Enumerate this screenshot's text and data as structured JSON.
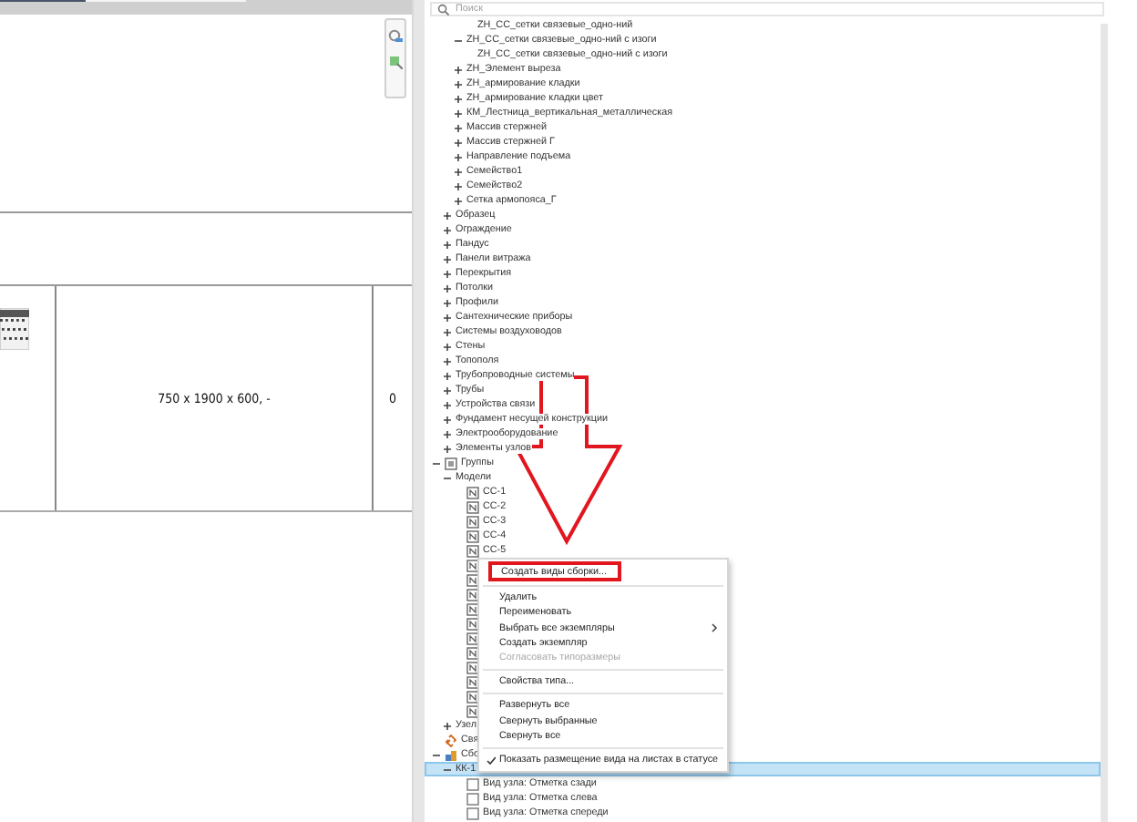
{
  "view": {
    "table": {
      "rows": [
        {
          "cells": [
            "750 x 1900 x 600, -",
            "0"
          ]
        }
      ]
    }
  },
  "search": {
    "placeholder": "Поиск"
  },
  "tree": [
    {
      "children": [
        {
          "children": [
            {
              "children": [
                {
                  "label": "ZH_CC_сетки связевые_одно-ний",
                  "selected": false
                }
              ]
            },
            {
              "label": "ZH_CC_сетки связевые_одно-ний с изоги",
              "expanded": true,
              "selected": false,
              "children": [
                {
                  "label": "ZH_CC_сетки связевые_одно-ний с изоги",
                  "selected": false
                }
              ]
            },
            {
              "label": "ZH_Элемент выреза",
              "expanded": false,
              "selected": false
            },
            {
              "label": "ZH_армирование кладки",
              "expanded": false,
              "selected": false
            },
            {
              "label": "ZH_армирование кладки цвет",
              "expanded": false,
              "selected": false
            },
            {
              "label": "КМ_Лестница_вертикальная_металлическая",
              "expanded": false,
              "selected": false
            },
            {
              "label": "Массив стержней",
              "expanded": false,
              "selected": false
            },
            {
              "label": "Массив стержней Г",
              "expanded": false,
              "selected": false
            },
            {
              "label": "Направление подъема",
              "expanded": false,
              "selected": false
            },
            {
              "label": "Семейство1",
              "expanded": false,
              "selected": false
            },
            {
              "label": "Семейство2",
              "expanded": false,
              "selected": false
            },
            {
              "label": "Сетка армопояса_Г",
              "expanded": false,
              "selected": false
            }
          ]
        },
        {
          "label": "Образец",
          "expanded": false,
          "selected": false
        },
        {
          "label": "Ограждение",
          "expanded": false,
          "selected": false
        },
        {
          "label": "Пандус",
          "expanded": false,
          "selected": false
        },
        {
          "label": "Панели витража",
          "expanded": false,
          "selected": false
        },
        {
          "label": "Перекрытия",
          "expanded": false,
          "selected": false
        },
        {
          "label": "Потолки",
          "expanded": false,
          "selected": false
        },
        {
          "label": "Профили",
          "expanded": false,
          "selected": false
        },
        {
          "label": "Сантехнические приборы",
          "expanded": false,
          "selected": false
        },
        {
          "label": "Системы воздуховодов",
          "expanded": false,
          "selected": false
        },
        {
          "label": "Стены",
          "expanded": false,
          "selected": false
        },
        {
          "label": "Топополя",
          "expanded": false,
          "selected": false
        },
        {
          "label": "Трубопроводные системы",
          "expanded": false,
          "selected": false
        },
        {
          "label": "Трубы",
          "expanded": false,
          "selected": false
        },
        {
          "label": "Устройства связи",
          "expanded": false,
          "selected": false
        },
        {
          "label": "Фундамент несущей конструкции",
          "expanded": false,
          "selected": false
        },
        {
          "label": "Электрооборудование",
          "expanded": false,
          "selected": false
        },
        {
          "label": "Элементы узлов",
          "expanded": false,
          "selected": false
        }
      ]
    },
    {
      "label": "Группы",
      "kind": "group",
      "expanded": true,
      "selected": false,
      "children": [
        {
          "label": "Модели",
          "expanded": true,
          "selected": false,
          "children": [
            {
              "label": "CC-1",
              "kind": "model",
              "selected": false
            },
            {
              "label": "CC-2",
              "kind": "model",
              "selected": false
            },
            {
              "label": "CC-3",
              "kind": "model",
              "selected": false
            },
            {
              "label": "CC-4",
              "kind": "model",
              "selected": false
            },
            {
              "label": "CC-5",
              "kind": "model",
              "selected": false
            },
            {
              "kind": "model",
              "selected": false
            },
            {
              "kind": "model",
              "selected": false
            },
            {
              "kind": "model",
              "selected": false
            },
            {
              "kind": "model",
              "selected": false
            },
            {
              "kind": "model",
              "selected": false
            },
            {
              "kind": "model",
              "selected": false
            },
            {
              "kind": "model",
              "selected": false
            },
            {
              "kind": "model",
              "selected": false
            },
            {
              "kind": "model",
              "selected": false
            },
            {
              "kind": "model",
              "selected": false
            },
            {
              "kind": "model",
              "selected": false
            }
          ]
        },
        {
          "label": "Узел",
          "expanded": false,
          "selected": false
        }
      ]
    },
    {
      "label": "Свя",
      "kind": "link",
      "selected": false
    },
    {
      "label": "Сбо",
      "kind": "assembly",
      "expanded": true,
      "selected": false,
      "children": [
        {
          "label": "КК-1",
          "expanded": true,
          "selected": true,
          "children": [
            {
              "label": "Вид узла: Отметка сзади",
              "kind": "view",
              "selected": false
            },
            {
              "label": "Вид узла: Отметка слева",
              "kind": "view",
              "selected": false
            },
            {
              "label": "Вид узла: Отметка спереди",
              "kind": "view",
              "selected": false
            }
          ]
        }
      ]
    }
  ],
  "context_menu": {
    "items": [
      {
        "kind": "item",
        "label": "Создать виды сборки...",
        "marked": true
      },
      {
        "kind": "separator"
      },
      {
        "kind": "item",
        "label": "Удалить"
      },
      {
        "kind": "item",
        "label": "Переименовать"
      },
      {
        "kind": "item",
        "label": "Выбрать все экземпляры",
        "submenu": true
      },
      {
        "kind": "item",
        "label": "Создать экземпляр"
      },
      {
        "kind": "item",
        "label": "Согласовать типоразмеры",
        "disabled": true
      },
      {
        "kind": "separator"
      },
      {
        "kind": "item",
        "label": "Свойства типа..."
      },
      {
        "kind": "separator"
      },
      {
        "kind": "item",
        "label": "Развернуть все"
      },
      {
        "kind": "item",
        "label": "Свернуть выбранные"
      },
      {
        "kind": "item",
        "label": "Свернуть все"
      },
      {
        "kind": "separator"
      },
      {
        "kind": "item",
        "label": "Показать размещение вида на листах в статусе",
        "checked": true
      }
    ]
  }
}
